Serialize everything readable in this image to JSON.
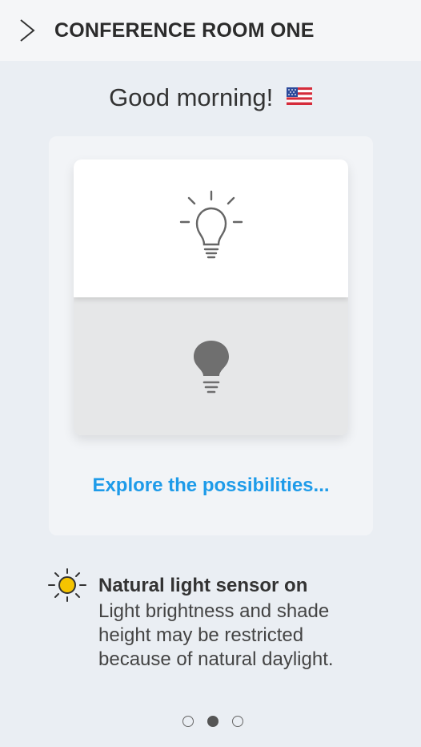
{
  "header": {
    "room_name": "CONFERENCE ROOM ONE",
    "back_icon": "chevron-right-icon"
  },
  "greeting": {
    "text": "Good morning!",
    "flag_icon": "us-flag-icon"
  },
  "light_switch": {
    "on_icon": "lightbulb-on-icon",
    "off_icon": "lightbulb-off-icon"
  },
  "explore": {
    "label": "Explore the possibilities..."
  },
  "sensor": {
    "icon": "sun-icon",
    "title": "Natural light sensor on",
    "description": "Light brightness and shade height may be restricted because of natural daylight."
  },
  "pager": {
    "count": 3,
    "active_index": 1
  },
  "colors": {
    "background": "#eaeef3",
    "header_bg": "#f5f6f8",
    "link": "#1e9be9",
    "sun": "#f5c400"
  }
}
